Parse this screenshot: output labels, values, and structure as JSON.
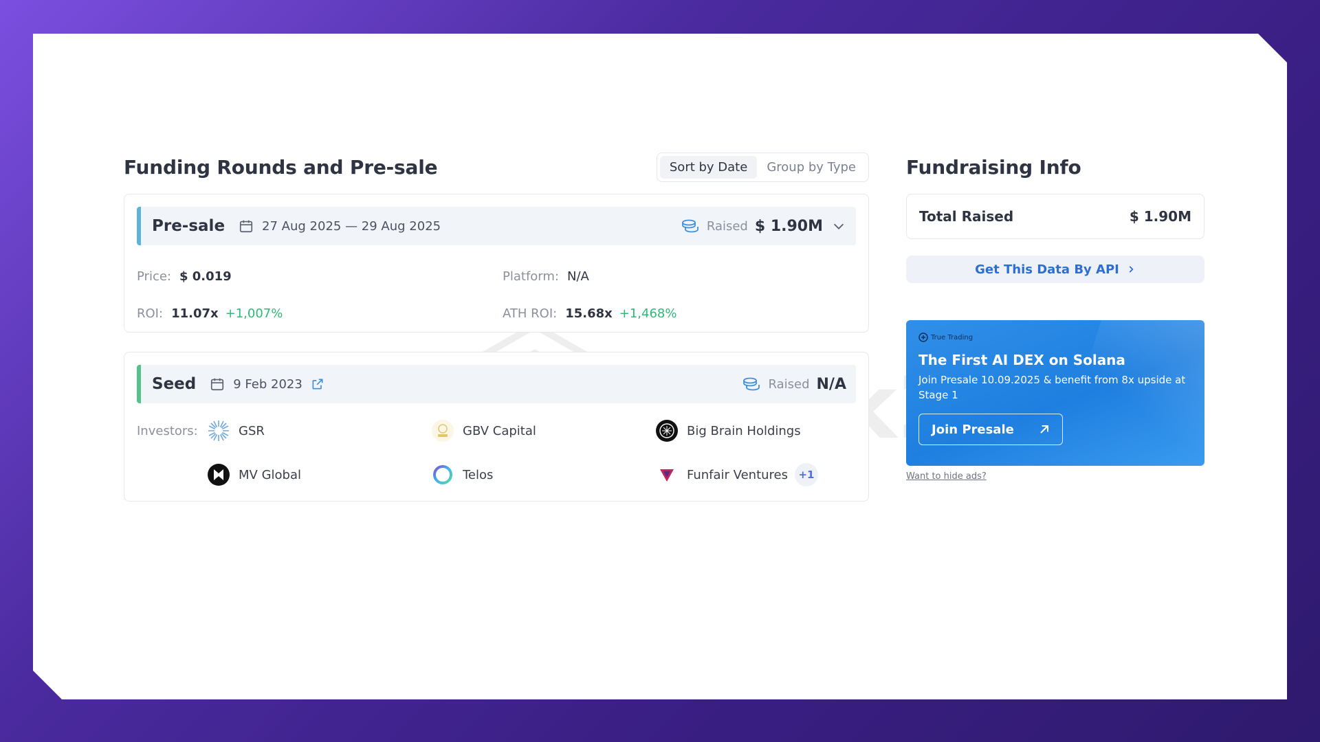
{
  "watermark": {
    "text": "block24"
  },
  "funding": {
    "title": "Funding Rounds and Pre-sale",
    "sort_options": [
      {
        "label": "Sort by Date",
        "active": true
      },
      {
        "label": "Group by Type",
        "active": false
      }
    ],
    "presale": {
      "name": "Pre-sale",
      "date": "27 Aug 2025 — 29 Aug 2025",
      "raised_label": "Raised",
      "raised_value": "$ 1.90M",
      "price_label": "Price:",
      "price_value": "$ 0.019",
      "platform_label": "Platform:",
      "platform_value": "N/A",
      "roi_label": "ROI:",
      "roi_value": "11.07x",
      "roi_pct": "+1,007%",
      "ath_roi_label": "ATH ROI:",
      "ath_roi_value": "15.68x",
      "ath_roi_pct": "+1,468%"
    },
    "seed": {
      "name": "Seed",
      "date": "9 Feb 2023",
      "raised_label": "Raised",
      "raised_value": "N/A",
      "investors_label": "Investors:",
      "investors": [
        {
          "name": "GSR",
          "icon": "gsr-logo-icon"
        },
        {
          "name": "GBV Capital",
          "icon": "gbv-capital-logo-icon"
        },
        {
          "name": "Big Brain Holdings",
          "icon": "big-brain-holdings-logo-icon"
        },
        {
          "name": "MV Global",
          "icon": "mv-global-logo-icon"
        },
        {
          "name": "Telos",
          "icon": "telos-logo-icon"
        },
        {
          "name": "Funfair Ventures",
          "icon": "funfair-ventures-logo-icon"
        }
      ],
      "more_count": "+1"
    }
  },
  "fundraising": {
    "title": "Fundraising Info",
    "total_label": "Total Raised",
    "total_value": "$ 1.90M",
    "api_label": "Get This Data By API"
  },
  "ad": {
    "brand": "True Trading",
    "title": "The First AI DEX on Solana",
    "subtitle": "Join Presale 10.09.2025 & benefit from 8x upside at Stage 1",
    "cta": "Join Presale",
    "hide_link": "Want to hide ads?"
  },
  "colors": {
    "accent": "#2d6fd1",
    "positive": "#2fb876",
    "presale_bar": "#5cb4dd",
    "seed_bar": "#53c28b",
    "ad_bg": "#1f7fe0"
  }
}
